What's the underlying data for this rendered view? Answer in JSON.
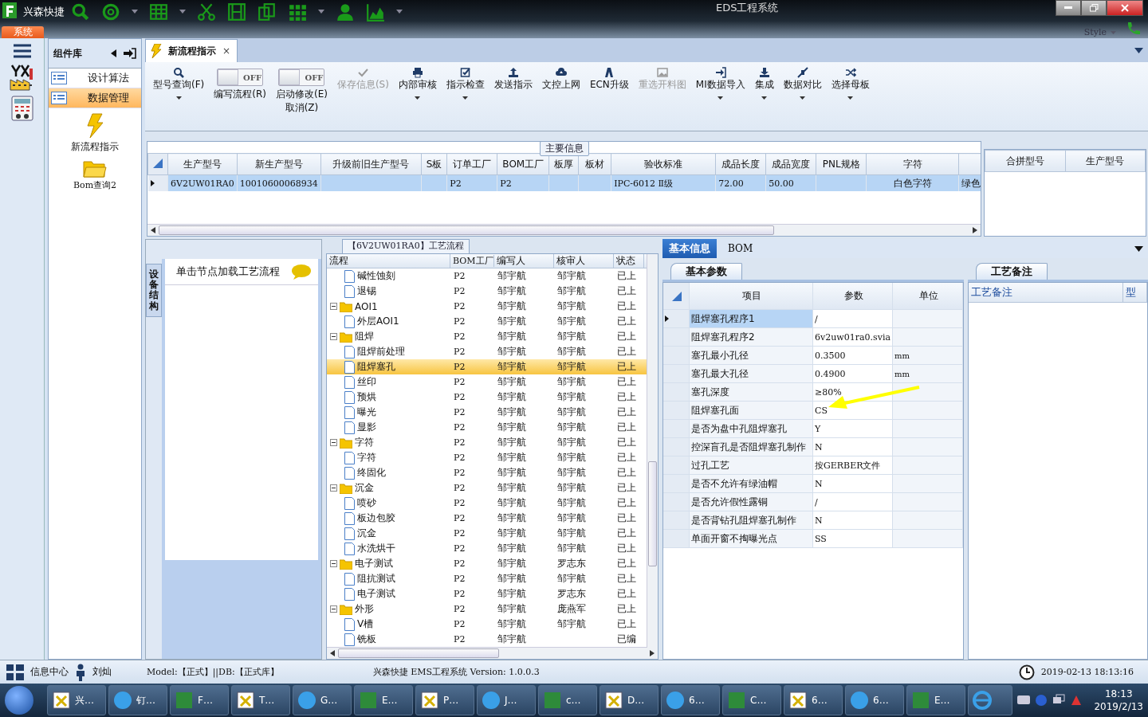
{
  "title_bar": {
    "app_name": "兴森快捷",
    "title": "EDS工程系统",
    "style_label": "Style",
    "menu_tab": "系统"
  },
  "tab_strip": {
    "tabs": [
      {
        "label": "新流程指示",
        "selected": true,
        "close": "×"
      }
    ]
  },
  "ribbon": [
    {
      "kind": "button",
      "label": "型号查询(F)",
      "disabled": false,
      "dropdown": true
    },
    {
      "kind": "toggle",
      "label": "编写流程(R)",
      "state_text": "OFF",
      "on": false
    },
    {
      "kind": "toggle",
      "label": "启动修改(E)\n取消(Z)",
      "state_text": "OFF",
      "on": false
    },
    {
      "kind": "button",
      "label": "保存信息(S)",
      "disabled": true,
      "dropdown": false
    },
    {
      "kind": "button",
      "label": "内部审核",
      "disabled": false,
      "dropdown": true
    },
    {
      "kind": "button",
      "label": "指示检查",
      "disabled": false,
      "dropdown": true
    },
    {
      "kind": "button",
      "label": "发送指示",
      "disabled": false,
      "dropdown": false
    },
    {
      "kind": "button",
      "label": "文控上网",
      "disabled": false,
      "dropdown": false
    },
    {
      "kind": "button",
      "label": "ECN升级",
      "disabled": false,
      "dropdown": false
    },
    {
      "kind": "button",
      "label": "重选开料图",
      "disabled": true,
      "dropdown": false
    },
    {
      "kind": "button",
      "label": "MI数据导入",
      "disabled": false,
      "dropdown": true
    },
    {
      "kind": "button",
      "label": "集成",
      "disabled": false,
      "dropdown": true
    },
    {
      "kind": "button",
      "label": "数据对比",
      "disabled": false,
      "dropdown": true
    },
    {
      "kind": "button",
      "label": "选择母板",
      "disabled": false,
      "dropdown": true
    }
  ],
  "component_panel": {
    "title": "组件库",
    "items": [
      {
        "label": "设计算法",
        "selected": false
      },
      {
        "label": "数据管理",
        "selected": true
      }
    ],
    "tools": [
      {
        "label": "新流程指示"
      },
      {
        "label": "Bom查询2"
      }
    ]
  },
  "main_info": {
    "title": "主要信息",
    "table": {
      "columns": [
        "生产型号",
        "新生产型号",
        "升级前旧生产型号",
        "S板",
        "订单工厂",
        "BOM工厂",
        "板厚",
        "板材",
        "验收标准",
        "成品长度",
        "成品宽度",
        "PNL规格",
        "字符"
      ],
      "rows": [
        {
          "selected": true,
          "cells": [
            "6V2UW01RA0",
            "10010600068934",
            null,
            null,
            "P2",
            "P2",
            null,
            null,
            "IPC-6012 Ⅱ级",
            "72.00",
            "50.00",
            null,
            "白色字符",
            "绿色"
          ]
        }
      ]
    },
    "side_table": {
      "columns": [
        "合拼型号",
        "生产型号"
      ]
    }
  },
  "left_panel": {
    "vertical_tab": "设备结构",
    "hint": "单击节点加载工艺流程"
  },
  "process": {
    "title": "【6V2UW01RA0】工艺流程",
    "columns": [
      "流程",
      "BOM工厂",
      "编写人",
      "核审人",
      "状态"
    ],
    "tree": [
      {
        "children": [
          {
            "label": "碱性蚀刻",
            "bom": "P2",
            "writer": "邹宇航",
            "reviewer": "邹宇航",
            "status": "已上",
            "selected": false
          },
          {
            "label": "退锡",
            "bom": "P2",
            "writer": "邹宇航",
            "reviewer": "邹宇航",
            "status": "已上",
            "selected": false
          }
        ]
      },
      {
        "label": "AOI1",
        "bom": "P2",
        "writer": "邹宇航",
        "reviewer": "邹宇航",
        "status": "已上",
        "selected": false,
        "expanded": true,
        "children": [
          {
            "label": "外层AOI1",
            "bom": "P2",
            "writer": "邹宇航",
            "reviewer": "邹宇航",
            "status": "已上",
            "selected": false
          }
        ]
      },
      {
        "label": "阻焊",
        "bom": "P2",
        "writer": "邹宇航",
        "reviewer": "邹宇航",
        "status": "已上",
        "selected": false,
        "expanded": true,
        "children": [
          {
            "label": "阻焊前处理",
            "bom": "P2",
            "writer": "邹宇航",
            "reviewer": "邹宇航",
            "status": "已上",
            "selected": false
          },
          {
            "label": "阻焊塞孔",
            "bom": "P2",
            "writer": "邹宇航",
            "reviewer": "邹宇航",
            "status": "已上",
            "selected": true
          },
          {
            "label": "丝印",
            "bom": "P2",
            "writer": "邹宇航",
            "reviewer": "邹宇航",
            "status": "已上",
            "selected": false
          },
          {
            "label": "预烘",
            "bom": "P2",
            "writer": "邹宇航",
            "reviewer": "邹宇航",
            "status": "已上",
            "selected": false
          },
          {
            "label": "曝光",
            "bom": "P2",
            "writer": "邹宇航",
            "reviewer": "邹宇航",
            "status": "已上",
            "selected": false
          },
          {
            "label": "显影",
            "bom": "P2",
            "writer": "邹宇航",
            "reviewer": "邹宇航",
            "status": "已上",
            "selected": false
          }
        ]
      },
      {
        "label": "字符",
        "bom": "P2",
        "writer": "邹宇航",
        "reviewer": "邹宇航",
        "status": "已上",
        "selected": false,
        "expanded": true,
        "children": [
          {
            "label": "字符",
            "bom": "P2",
            "writer": "邹宇航",
            "reviewer": "邹宇航",
            "status": "已上",
            "selected": false
          },
          {
            "label": "终固化",
            "bom": "P2",
            "writer": "邹宇航",
            "reviewer": "邹宇航",
            "status": "已上",
            "selected": false
          }
        ]
      },
      {
        "label": "沉金",
        "bom": "P2",
        "writer": "邹宇航",
        "reviewer": "邹宇航",
        "status": "已上",
        "selected": false,
        "expanded": true,
        "children": [
          {
            "label": "喷砂",
            "bom": "P2",
            "writer": "邹宇航",
            "reviewer": "邹宇航",
            "status": "已上",
            "selected": false
          },
          {
            "label": "板边包胶",
            "bom": "P2",
            "writer": "邹宇航",
            "reviewer": "邹宇航",
            "status": "已上",
            "selected": false
          },
          {
            "label": "沉金",
            "bom": "P2",
            "writer": "邹宇航",
            "reviewer": "邹宇航",
            "status": "已上",
            "selected": false
          },
          {
            "label": "水洗烘干",
            "bom": "P2",
            "writer": "邹宇航",
            "reviewer": "邹宇航",
            "status": "已上",
            "selected": false
          }
        ]
      },
      {
        "label": "电子测试",
        "bom": "P2",
        "writer": "邹宇航",
        "reviewer": "罗志东",
        "status": "已上",
        "selected": false,
        "expanded": true,
        "children": [
          {
            "label": "阻抗测试",
            "bom": "P2",
            "writer": "邹宇航",
            "reviewer": "邹宇航",
            "status": "已上",
            "selected": false
          },
          {
            "label": "电子测试",
            "bom": "P2",
            "writer": "邹宇航",
            "reviewer": "罗志东",
            "status": "已上",
            "selected": false
          }
        ]
      },
      {
        "label": "外形",
        "bom": "P2",
        "writer": "邹宇航",
        "reviewer": "庞燕军",
        "status": "已上",
        "selected": false,
        "expanded": true,
        "children": [
          {
            "label": "V槽",
            "bom": "P2",
            "writer": "邹宇航",
            "reviewer": "邹宇航",
            "status": "已上",
            "selected": false
          },
          {
            "label": "铣板",
            "bom": "P2",
            "writer": "邹宇航",
            "status": "已编",
            "selected": false
          }
        ]
      }
    ]
  },
  "detail": {
    "tabs": [
      {
        "label": "基本信息",
        "selected": true
      },
      {
        "label": "BOM",
        "selected": false
      }
    ],
    "sub_tab": "基本参数",
    "columns": [
      "项目",
      "参数",
      "单位"
    ],
    "rows": [
      {
        "item": "阻焊塞孔程序1",
        "value": "/",
        "selected": true
      },
      {
        "item": "阻焊塞孔程序2",
        "value": "6v2uw01ra0.svia",
        "selected": false
      },
      {
        "item": "塞孔最小孔径",
        "value": "0.3500",
        "unit": "mm",
        "selected": false
      },
      {
        "item": "塞孔最大孔径",
        "value": "0.4900",
        "unit": "mm",
        "selected": false
      },
      {
        "item": "塞孔深度",
        "value": "≥80%",
        "selected": false
      },
      {
        "item": "阻焊塞孔面",
        "value": "CS",
        "selected": false
      },
      {
        "item": "是否为盘中孔阻焊塞孔",
        "value": "Y",
        "selected": false
      },
      {
        "item": "控深盲孔是否阻焊塞孔制作",
        "value": "N",
        "selected": false
      },
      {
        "item": "过孔工艺",
        "value": "按GERBER文件",
        "selected": false
      },
      {
        "item": "是否不允许有绿油帽",
        "value": "N",
        "selected": false
      },
      {
        "item": "是否允许假性露铜",
        "value": "/",
        "selected": false
      },
      {
        "item": "是否背钻孔阻焊塞孔制作",
        "value": "N",
        "selected": false
      },
      {
        "item": "单面开窗不掏曝光点",
        "value": "SS",
        "selected": false
      }
    ],
    "notes": {
      "tab": "工艺备注",
      "columns": [
        "工艺备注",
        "型"
      ]
    }
  },
  "status_bar": {
    "info_center": "信息中心",
    "user": "刘灿",
    "model": "Model:【正式】||DB:【正式库】",
    "version": "兴森快捷 EMS工程系统 Version: 1.0.0.3",
    "datetime": "2019-02-13 18:13:16"
  },
  "taskbar": {
    "tasks": [
      "兴…",
      "钉…",
      "F…",
      "T…",
      "G…",
      "E…",
      "P…",
      "J…",
      "c…",
      "D…",
      "6…",
      "C…",
      "6…",
      "6…",
      "E…"
    ],
    "time": "18:13",
    "date": "2019/2/13"
  }
}
